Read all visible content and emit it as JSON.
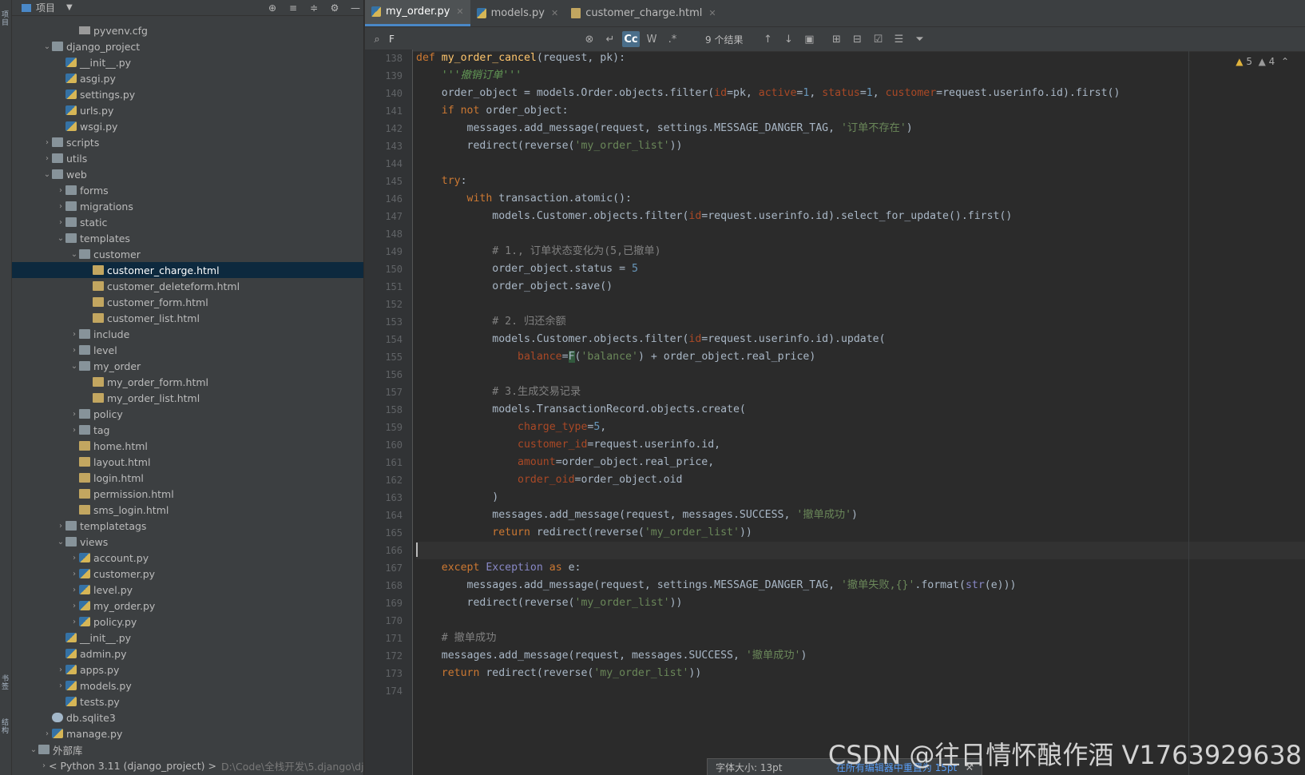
{
  "side_strip": {
    "top_label": "项目",
    "bottom_label1": "书签",
    "bottom_label2": "结构"
  },
  "project": {
    "title": "项目"
  },
  "tree": [
    {
      "label": "pyvenv.cfg",
      "indent": 4,
      "icon": "txt",
      "chevron": ""
    },
    {
      "label": "django_project",
      "indent": 2,
      "icon": "folder",
      "chevron": "down"
    },
    {
      "label": "__init__.py",
      "indent": 3,
      "icon": "py",
      "chevron": ""
    },
    {
      "label": "asgi.py",
      "indent": 3,
      "icon": "py",
      "chevron": ""
    },
    {
      "label": "settings.py",
      "indent": 3,
      "icon": "py",
      "chevron": ""
    },
    {
      "label": "urls.py",
      "indent": 3,
      "icon": "py",
      "chevron": ""
    },
    {
      "label": "wsgi.py",
      "indent": 3,
      "icon": "py",
      "chevron": ""
    },
    {
      "label": "scripts",
      "indent": 2,
      "icon": "folder",
      "chevron": "right"
    },
    {
      "label": "utils",
      "indent": 2,
      "icon": "folder",
      "chevron": "right"
    },
    {
      "label": "web",
      "indent": 2,
      "icon": "folder",
      "chevron": "down"
    },
    {
      "label": "forms",
      "indent": 3,
      "icon": "folder",
      "chevron": "right"
    },
    {
      "label": "migrations",
      "indent": 3,
      "icon": "folder",
      "chevron": "right"
    },
    {
      "label": "static",
      "indent": 3,
      "icon": "folder",
      "chevron": "right"
    },
    {
      "label": "templates",
      "indent": 3,
      "icon": "folder",
      "chevron": "down"
    },
    {
      "label": "customer",
      "indent": 4,
      "icon": "folder",
      "chevron": "down"
    },
    {
      "label": "customer_charge.html",
      "indent": 5,
      "icon": "html",
      "chevron": "",
      "selected": true
    },
    {
      "label": "customer_deleteform.html",
      "indent": 5,
      "icon": "html",
      "chevron": ""
    },
    {
      "label": "customer_form.html",
      "indent": 5,
      "icon": "html",
      "chevron": ""
    },
    {
      "label": "customer_list.html",
      "indent": 5,
      "icon": "html",
      "chevron": ""
    },
    {
      "label": "include",
      "indent": 4,
      "icon": "folder",
      "chevron": "right"
    },
    {
      "label": "level",
      "indent": 4,
      "icon": "folder",
      "chevron": "right"
    },
    {
      "label": "my_order",
      "indent": 4,
      "icon": "folder",
      "chevron": "down"
    },
    {
      "label": "my_order_form.html",
      "indent": 5,
      "icon": "html",
      "chevron": ""
    },
    {
      "label": "my_order_list.html",
      "indent": 5,
      "icon": "html",
      "chevron": ""
    },
    {
      "label": "policy",
      "indent": 4,
      "icon": "folder",
      "chevron": "right"
    },
    {
      "label": "tag",
      "indent": 4,
      "icon": "folder",
      "chevron": "right"
    },
    {
      "label": "home.html",
      "indent": 4,
      "icon": "html",
      "chevron": ""
    },
    {
      "label": "layout.html",
      "indent": 4,
      "icon": "html",
      "chevron": ""
    },
    {
      "label": "login.html",
      "indent": 4,
      "icon": "html",
      "chevron": ""
    },
    {
      "label": "permission.html",
      "indent": 4,
      "icon": "html",
      "chevron": ""
    },
    {
      "label": "sms_login.html",
      "indent": 4,
      "icon": "html",
      "chevron": ""
    },
    {
      "label": "templatetags",
      "indent": 3,
      "icon": "folder",
      "chevron": "right"
    },
    {
      "label": "views",
      "indent": 3,
      "icon": "folder",
      "chevron": "down"
    },
    {
      "label": "account.py",
      "indent": 4,
      "icon": "py",
      "chevron": "right"
    },
    {
      "label": "customer.py",
      "indent": 4,
      "icon": "py",
      "chevron": "right"
    },
    {
      "label": "level.py",
      "indent": 4,
      "icon": "py",
      "chevron": "right"
    },
    {
      "label": "my_order.py",
      "indent": 4,
      "icon": "py",
      "chevron": "right"
    },
    {
      "label": "policy.py",
      "indent": 4,
      "icon": "py",
      "chevron": "right"
    },
    {
      "label": "__init__.py",
      "indent": 3,
      "icon": "py",
      "chevron": ""
    },
    {
      "label": "admin.py",
      "indent": 3,
      "icon": "py",
      "chevron": ""
    },
    {
      "label": "apps.py",
      "indent": 3,
      "icon": "py",
      "chevron": "right"
    },
    {
      "label": "models.py",
      "indent": 3,
      "icon": "py",
      "chevron": "right"
    },
    {
      "label": "tests.py",
      "indent": 3,
      "icon": "py",
      "chevron": ""
    },
    {
      "label": "db.sqlite3",
      "indent": 2,
      "icon": "db",
      "chevron": ""
    },
    {
      "label": "manage.py",
      "indent": 2,
      "icon": "py",
      "chevron": "right"
    },
    {
      "label": "外部库",
      "indent": 1,
      "icon": "lib",
      "chevron": "down"
    },
    {
      "label": "< Python 3.11 (django_project) >",
      "indent": 2,
      "icon": "pylib",
      "chevron": "right",
      "suffix": "D:\\Code\\全栈开发\\5.django\\dj"
    }
  ],
  "tabs": [
    {
      "label": "my_order.py",
      "active": true
    },
    {
      "label": "models.py",
      "active": false
    },
    {
      "label": "customer_charge.html",
      "active": false
    }
  ],
  "find": {
    "query": "F",
    "result": "9 个结果",
    "cc": "Cc",
    "w": "W"
  },
  "warnings": {
    "w1": "5",
    "w2": "4"
  },
  "code": [
    {
      "n": "138",
      "h": "<span class=\"kw\">def</span> <span class=\"fn\">my_order_cancel</span>(request, pk):"
    },
    {
      "n": "139",
      "h": "    <span class=\"doc\">'''撤销订单'''</span>"
    },
    {
      "n": "140",
      "h": "    order_object = models.Order.objects.filter(<span class=\"pr\">id</span>=pk, <span class=\"pr\">active</span>=<span class=\"num\">1</span>, <span class=\"pr\">status</span>=<span class=\"num\">1</span>, <span class=\"pr\">customer</span>=request.userinfo.id).first()"
    },
    {
      "n": "141",
      "h": "    <span class=\"kw\">if not</span> order_object:"
    },
    {
      "n": "142",
      "h": "        messages.add_message(request, settings.MESSAGE_DANGER_TAG, <span class=\"str\">'订单不存在'</span>)"
    },
    {
      "n": "143",
      "h": "        redirect(reverse(<span class=\"str\">'my_order_list'</span>))"
    },
    {
      "n": "144",
      "h": ""
    },
    {
      "n": "145",
      "h": "    <span class=\"kw\">try</span>:"
    },
    {
      "n": "146",
      "h": "        <span class=\"kw\">with</span> transaction.atomic():"
    },
    {
      "n": "147",
      "h": "            models.Customer.objects.filter(<span class=\"pr\">id</span>=request.userinfo.id).select_for_update().first()"
    },
    {
      "n": "148",
      "h": ""
    },
    {
      "n": "149",
      "h": "            <span class=\"cm\"># 1., 订单状态变化为(5,已撤单)</span>"
    },
    {
      "n": "150",
      "h": "            order_object.status = <span class=\"num\">5</span>"
    },
    {
      "n": "151",
      "h": "            order_object.save()"
    },
    {
      "n": "152",
      "h": ""
    },
    {
      "n": "153",
      "h": "            <span class=\"cm\"># 2. 归还余额</span>"
    },
    {
      "n": "154",
      "h": "            models.Customer.objects.filter(<span class=\"pr\">id</span>=request.userinfo.id).update("
    },
    {
      "n": "155",
      "h": "                <span class=\"pr\">balance</span>=<span class=\"hl\">F</span>(<span class=\"str\">'balance'</span>) + order_object.real_price)"
    },
    {
      "n": "156",
      "h": ""
    },
    {
      "n": "157",
      "h": "            <span class=\"cm\"># 3.生成交易记录</span>"
    },
    {
      "n": "158",
      "h": "            models.TransactionRecord.objects.create("
    },
    {
      "n": "159",
      "h": "                <span class=\"pr\">charge_type</span>=<span class=\"num\">5</span>,"
    },
    {
      "n": "160",
      "h": "                <span class=\"pr\">customer_id</span>=request.userinfo.id,"
    },
    {
      "n": "161",
      "h": "                <span class=\"pr\">amount</span>=order_object.real_price,"
    },
    {
      "n": "162",
      "h": "                <span class=\"pr\">order_oid</span>=order_object.oid"
    },
    {
      "n": "163",
      "h": "            )"
    },
    {
      "n": "164",
      "h": "            messages.add_message(request, messages.SUCCESS, <span class=\"str\">'撤单成功'</span>)"
    },
    {
      "n": "165",
      "h": "            <span class=\"kw\">return</span> redirect(reverse(<span class=\"str\">'my_order_list'</span>))"
    },
    {
      "n": "166",
      "h": "",
      "cur": true
    },
    {
      "n": "167",
      "h": "    <span class=\"kw\">except</span> <span class=\"bi\">Exception</span> <span class=\"kw\">as</span> e:"
    },
    {
      "n": "168",
      "h": "        messages.add_message(request, settings.MESSAGE_DANGER_TAG, <span class=\"str\">'撤单失败,{}'</span>.format(<span class=\"bi\">str</span>(e)))"
    },
    {
      "n": "169",
      "h": "        redirect(reverse(<span class=\"str\">'my_order_list'</span>))"
    },
    {
      "n": "170",
      "h": ""
    },
    {
      "n": "171",
      "h": "    <span class=\"cm\"># 撤单成功</span>"
    },
    {
      "n": "172",
      "h": "    messages.add_message(request, messages.SUCCESS, <span class=\"str\">'撤单成功'</span>)"
    },
    {
      "n": "173",
      "h": "    <span class=\"kw\">return</span> redirect(reverse(<span class=\"str\">'my_order_list'</span>))"
    },
    {
      "n": "174",
      "h": ""
    }
  ],
  "font_popup": {
    "label": "字体大小: 13pt",
    "link": "在所有编辑器中重置为 15pt"
  },
  "watermark": "CSDN @往日情怀酿作酒 V1763929638"
}
